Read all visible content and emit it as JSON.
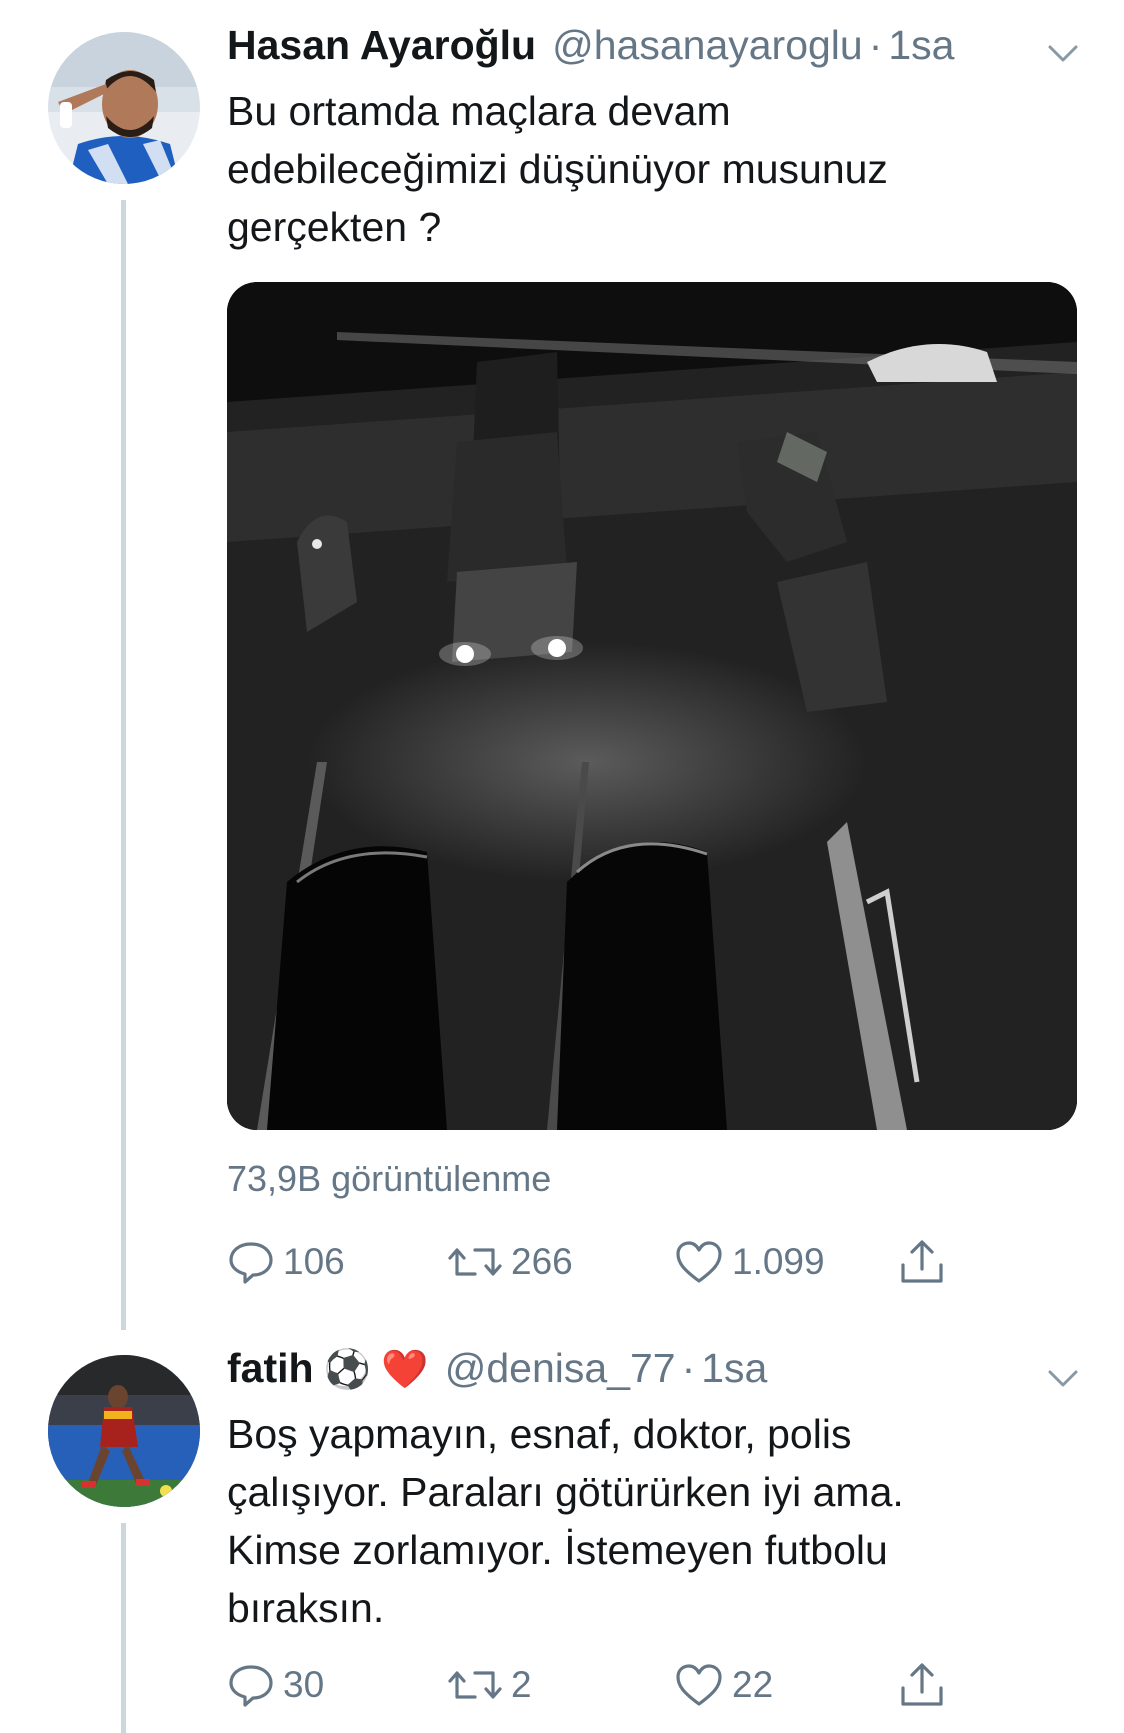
{
  "tweets": [
    {
      "name": "Hasan Ayaroğlu",
      "name_emoji": "",
      "handle": "@hasanayaroglu",
      "separator": "·",
      "time": "1sa",
      "text_lines": [
        "Bu ortamda maçlara devam",
        "edebileceğimizi düşünüyor musunuz",
        "gerçekten ?"
      ],
      "views": "73,9B görüntülenme",
      "replies": "106",
      "retweets": "266",
      "likes": "1.099"
    },
    {
      "name": "fatih",
      "name_emoji": "⚽ ❤️",
      "handle": "@denisa_77",
      "separator": "·",
      "time": "1sa",
      "text_lines": [
        "Boş yapmayın, esnaf, doktor, polis",
        "çalışıyor. Paraları götürürken iyi ama.",
        "Kimse zorlamıyor. İstemeyen futbolu",
        "bıraksın."
      ],
      "replies": "30",
      "retweets": "2",
      "likes": "22"
    }
  ],
  "icons": {
    "reply": "reply-icon",
    "retweet": "retweet-icon",
    "like": "heart-icon",
    "share": "share-icon",
    "more": "chevron-down-icon"
  },
  "colors": {
    "secondary_text": "#657786",
    "thread_line": "#ccd6dd",
    "heart_emoji": "#e0245e"
  }
}
